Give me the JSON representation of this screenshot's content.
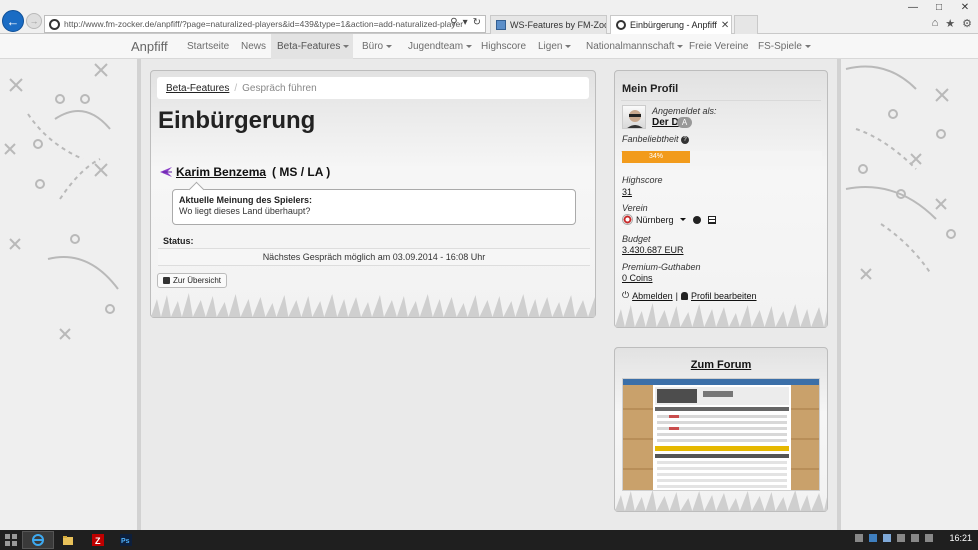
{
  "browser": {
    "url": "http://www.fm-zocker.de/anpfiff/?page=naturalized-players&id=439&type=1&action=add-naturalized-player",
    "tabs": [
      {
        "title": "WS-Features by FM-Zocker.de"
      },
      {
        "title": "Einbürgerung - Anpfiff"
      }
    ]
  },
  "nav": {
    "brand": "Anpfiff",
    "items": [
      {
        "label": "Startseite"
      },
      {
        "label": "News"
      },
      {
        "label": "Beta-Features"
      },
      {
        "label": "Büro"
      },
      {
        "label": "Jugendteam"
      },
      {
        "label": "Highscore"
      },
      {
        "label": "Ligen"
      },
      {
        "label": "Nationalmannschaft"
      },
      {
        "label": "Freie Vereine"
      },
      {
        "label": "FS-Spiele"
      }
    ]
  },
  "breadcrumb": {
    "link": "Beta-Features",
    "current": "Gespräch führen"
  },
  "main": {
    "title": "Einbürgerung",
    "player_name": "Karim Benzema",
    "player_positions": "( MS / LA )",
    "opinion_heading": "Aktuelle Meinung des Spielers:",
    "opinion_text": "Wo liegt dieses Land überhaupt?",
    "status_label": "Status:",
    "status_text": "Nächstes Gespräch möglich am 03.09.2014 - 16:08 Uhr",
    "overview_button": "Zur Übersicht"
  },
  "profile": {
    "title": "Mein Profil",
    "logged_as_label": "Angemeldet als:",
    "user_name": "Der D",
    "user_badge": "A",
    "fan_label": "Fanbeliebtheit",
    "fan_percent": "34%",
    "fan_value": 0.34,
    "highscore_label": "Highscore",
    "highscore_value": "31",
    "verein_label": "Verein",
    "verein_value": "Nürnberg",
    "budget_label": "Budget",
    "budget_value": "3.430.687 EUR",
    "premium_label": "Premium-Guthaben",
    "premium_value": "0 Coins",
    "logout_label": "Abmelden",
    "separator": "|",
    "edit_label": "Profil bearbeiten",
    "fan_color": "#f29b1b"
  },
  "forum": {
    "title": "Zum Forum"
  },
  "taskbar": {
    "time": "16:21"
  }
}
